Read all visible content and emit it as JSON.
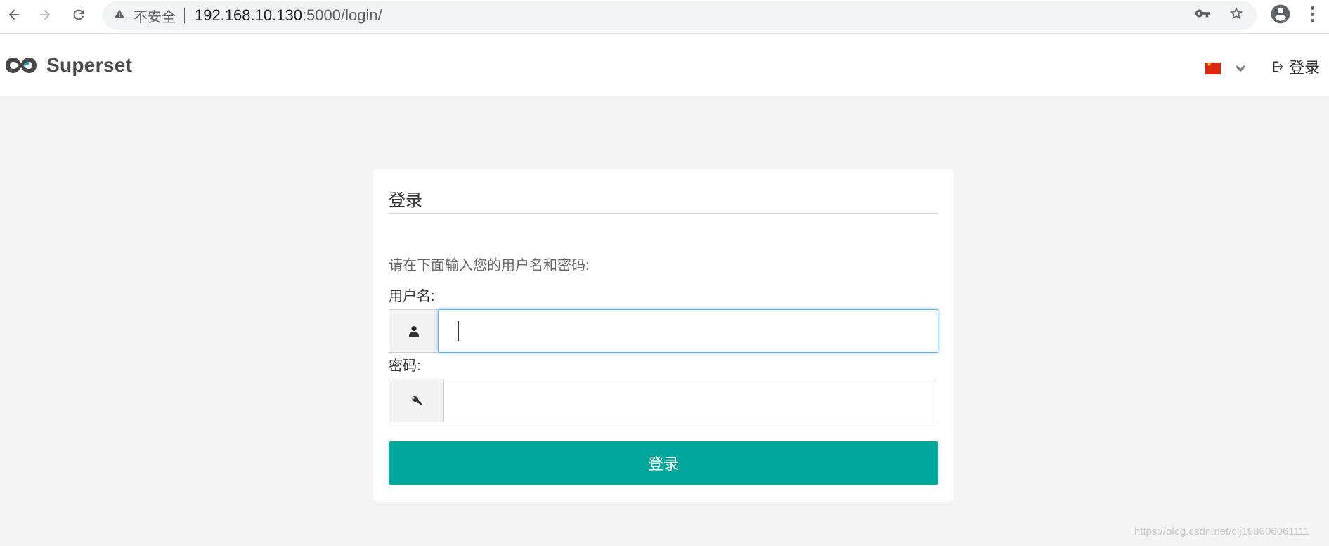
{
  "browser": {
    "insecure_label": "不安全",
    "url_host": "192.168.10.130",
    "url_rest": ":5000/login/"
  },
  "navbar": {
    "brand_name": "Superset",
    "login_label": "登录"
  },
  "login": {
    "title": "登录",
    "hint": "请在下面输入您的用户名和密码:",
    "username_label": "用户名:",
    "username_value": "",
    "password_label": "密码:",
    "password_value": "",
    "submit_label": "登录"
  },
  "watermark": "https://blog.csdn.net/clj198606061111",
  "colors": {
    "primary": "#00a699",
    "focus": "#66afe9",
    "page_bg": "#f4f4f4"
  }
}
